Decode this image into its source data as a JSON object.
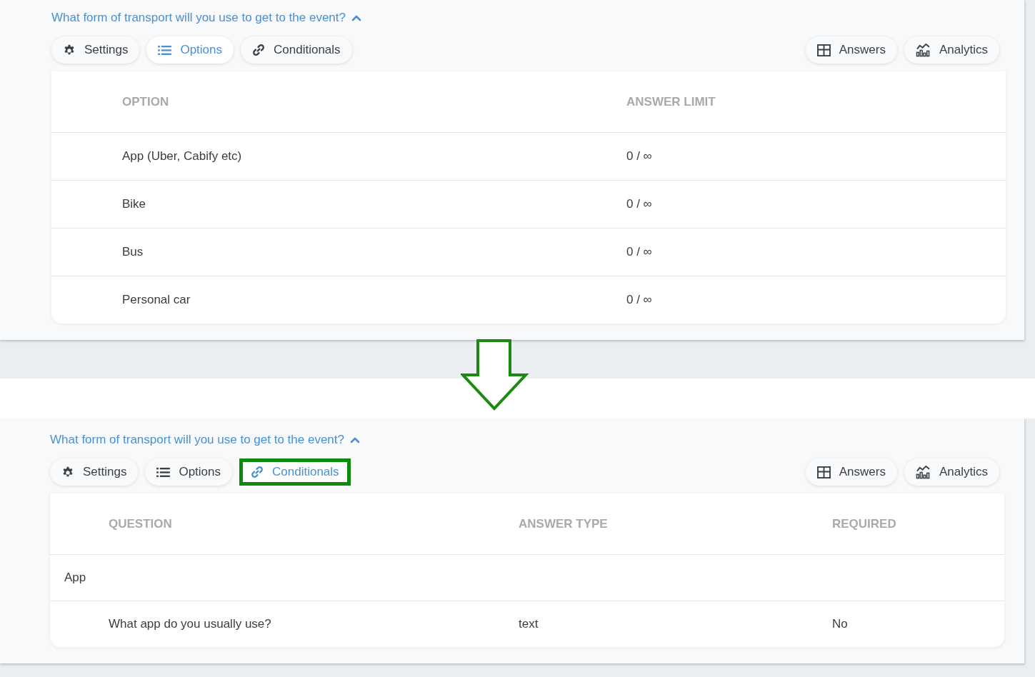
{
  "panels": [
    {
      "question": "What form of transport will you use to get to the event?",
      "expanded": true,
      "tabs": [
        {
          "label": "Settings",
          "kind": "gear",
          "selected": false,
          "highlighted": false
        },
        {
          "label": "Options",
          "kind": "list",
          "selected": true,
          "highlighted": false
        },
        {
          "label": "Conditionals",
          "kind": "link",
          "selected": false,
          "highlighted": false
        }
      ],
      "actions": [
        {
          "label": "Answers",
          "kind": "table"
        },
        {
          "label": "Analytics",
          "kind": "chart"
        }
      ],
      "table": {
        "columns": [
          "OPTION",
          "ANSWER LIMIT"
        ],
        "rows": [
          {
            "kind": "item",
            "cells": [
              "App (Uber, Cabify etc)",
              "0 / ∞"
            ]
          },
          {
            "kind": "item",
            "cells": [
              "Bike",
              "0 / ∞"
            ]
          },
          {
            "kind": "item",
            "cells": [
              "Bus",
              "0 / ∞"
            ]
          },
          {
            "kind": "item",
            "cells": [
              "Personal car",
              "0 / ∞"
            ]
          }
        ]
      }
    },
    {
      "question": "What form of transport will you use to get to the event?",
      "expanded": true,
      "tabs": [
        {
          "label": "Settings",
          "kind": "gear",
          "selected": false,
          "highlighted": false
        },
        {
          "label": "Options",
          "kind": "list",
          "selected": false,
          "highlighted": false
        },
        {
          "label": "Conditionals",
          "kind": "link",
          "selected": true,
          "highlighted": true
        }
      ],
      "actions": [
        {
          "label": "Answers",
          "kind": "table"
        },
        {
          "label": "Analytics",
          "kind": "chart"
        }
      ],
      "table": {
        "columns": [
          "QUESTION",
          "ANSWER TYPE",
          "REQUIRED"
        ],
        "rows": [
          {
            "kind": "group",
            "cells": [
              "App"
            ]
          },
          {
            "kind": "item",
            "cells": [
              "What app do you usually use?",
              "text",
              "No"
            ]
          }
        ]
      }
    }
  ]
}
